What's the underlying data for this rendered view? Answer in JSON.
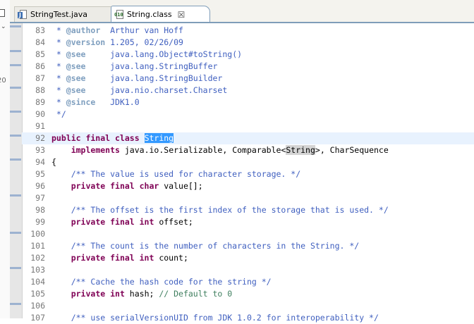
{
  "colors": {
    "keyword": "#7f0055",
    "javadoc": "#3f5fbf",
    "javadoc_tag": "#7f9fbf",
    "comment": "#3f7f5f",
    "selection": "#3399ff",
    "occurrence_highlight": "#d4d4d4",
    "current_line": "#e8f2fe",
    "tab_border": "#7f9db9"
  },
  "left_panel": {
    "icon": "window-fragment-icon",
    "chevron": "⌄",
    "number_fragment": "20"
  },
  "tabs": [
    {
      "label": "StringTest.java",
      "icon": "java-file-icon",
      "active": false
    },
    {
      "label": "String.class",
      "icon": "class-file-icon",
      "active": true,
      "close": "☒"
    }
  ],
  "editor": {
    "lines": [
      {
        "num": "83",
        "tokens": [
          {
            "t": " * ",
            "s": "javadoc"
          },
          {
            "t": "@author",
            "s": "tag"
          },
          {
            "t": "  Arthur van Hoff",
            "s": "javadoc"
          }
        ]
      },
      {
        "num": "84",
        "tokens": [
          {
            "t": " * ",
            "s": "javadoc"
          },
          {
            "t": "@version",
            "s": "tag"
          },
          {
            "t": " 1.205, 02/26/09",
            "s": "javadoc"
          }
        ]
      },
      {
        "num": "85",
        "tokens": [
          {
            "t": " * ",
            "s": "javadoc"
          },
          {
            "t": "@see",
            "s": "tag"
          },
          {
            "t": "     java.lang.Object#toString()",
            "s": "javadoc"
          }
        ]
      },
      {
        "num": "86",
        "tokens": [
          {
            "t": " * ",
            "s": "javadoc"
          },
          {
            "t": "@see",
            "s": "tag"
          },
          {
            "t": "     java.lang.StringBuffer",
            "s": "javadoc"
          }
        ]
      },
      {
        "num": "87",
        "tokens": [
          {
            "t": " * ",
            "s": "javadoc"
          },
          {
            "t": "@see",
            "s": "tag"
          },
          {
            "t": "     java.lang.StringBuilder",
            "s": "javadoc"
          }
        ]
      },
      {
        "num": "88",
        "tokens": [
          {
            "t": " * ",
            "s": "javadoc"
          },
          {
            "t": "@see",
            "s": "tag"
          },
          {
            "t": "     java.nio.charset.Charset",
            "s": "javadoc"
          }
        ]
      },
      {
        "num": "89",
        "tokens": [
          {
            "t": " * ",
            "s": "javadoc"
          },
          {
            "t": "@since",
            "s": "tag"
          },
          {
            "t": "   JDK1.0",
            "s": "javadoc"
          }
        ]
      },
      {
        "num": "90",
        "tokens": [
          {
            "t": " */",
            "s": "javadoc"
          }
        ]
      },
      {
        "num": "91",
        "tokens": []
      },
      {
        "num": "92",
        "current": true,
        "tokens": [
          {
            "t": "public final class",
            "s": "keyword"
          },
          {
            "t": " ",
            "s": "plain"
          },
          {
            "t": "String",
            "s": "selected"
          }
        ]
      },
      {
        "num": "93",
        "tokens": [
          {
            "t": "    ",
            "s": "plain"
          },
          {
            "t": "implements",
            "s": "keyword"
          },
          {
            "t": " java.io.Serializable, Comparable<",
            "s": "plain"
          },
          {
            "t": "String",
            "s": "occurrence"
          },
          {
            "t": ">, CharSequence",
            "s": "plain"
          }
        ]
      },
      {
        "num": "94",
        "tokens": [
          {
            "t": "{",
            "s": "plain"
          }
        ]
      },
      {
        "num": "95",
        "tokens": [
          {
            "t": "    ",
            "s": "plain"
          },
          {
            "t": "/** The value is used for character storage. */",
            "s": "javadoc"
          }
        ]
      },
      {
        "num": "96",
        "tokens": [
          {
            "t": "    ",
            "s": "plain"
          },
          {
            "t": "private final char",
            "s": "keyword"
          },
          {
            "t": " value[];",
            "s": "plain"
          }
        ]
      },
      {
        "num": "97",
        "tokens": []
      },
      {
        "num": "98",
        "tokens": [
          {
            "t": "    ",
            "s": "plain"
          },
          {
            "t": "/** The offset is the first index of the storage that is used. */",
            "s": "javadoc"
          }
        ]
      },
      {
        "num": "99",
        "tokens": [
          {
            "t": "    ",
            "s": "plain"
          },
          {
            "t": "private final int",
            "s": "keyword"
          },
          {
            "t": " offset;",
            "s": "plain"
          }
        ]
      },
      {
        "num": "100",
        "tokens": []
      },
      {
        "num": "101",
        "tokens": [
          {
            "t": "    ",
            "s": "plain"
          },
          {
            "t": "/** The count is the number of characters in the String. */",
            "s": "javadoc"
          }
        ]
      },
      {
        "num": "102",
        "tokens": [
          {
            "t": "    ",
            "s": "plain"
          },
          {
            "t": "private final int",
            "s": "keyword"
          },
          {
            "t": " count;",
            "s": "plain"
          }
        ]
      },
      {
        "num": "103",
        "tokens": []
      },
      {
        "num": "104",
        "tokens": [
          {
            "t": "    ",
            "s": "plain"
          },
          {
            "t": "/** Cache the hash code for the string */",
            "s": "javadoc"
          }
        ]
      },
      {
        "num": "105",
        "tokens": [
          {
            "t": "    ",
            "s": "plain"
          },
          {
            "t": "private int",
            "s": "keyword"
          },
          {
            "t": " hash; ",
            "s": "plain"
          },
          {
            "t": "// Default to 0",
            "s": "comment"
          }
        ]
      },
      {
        "num": "106",
        "tokens": []
      },
      {
        "num": "107",
        "tokens": [
          {
            "t": "    ",
            "s": "plain"
          },
          {
            "t": "/** use serialVersionUID from JDK 1.0.2 for interoperability */",
            "s": "javadoc"
          }
        ]
      }
    ]
  }
}
